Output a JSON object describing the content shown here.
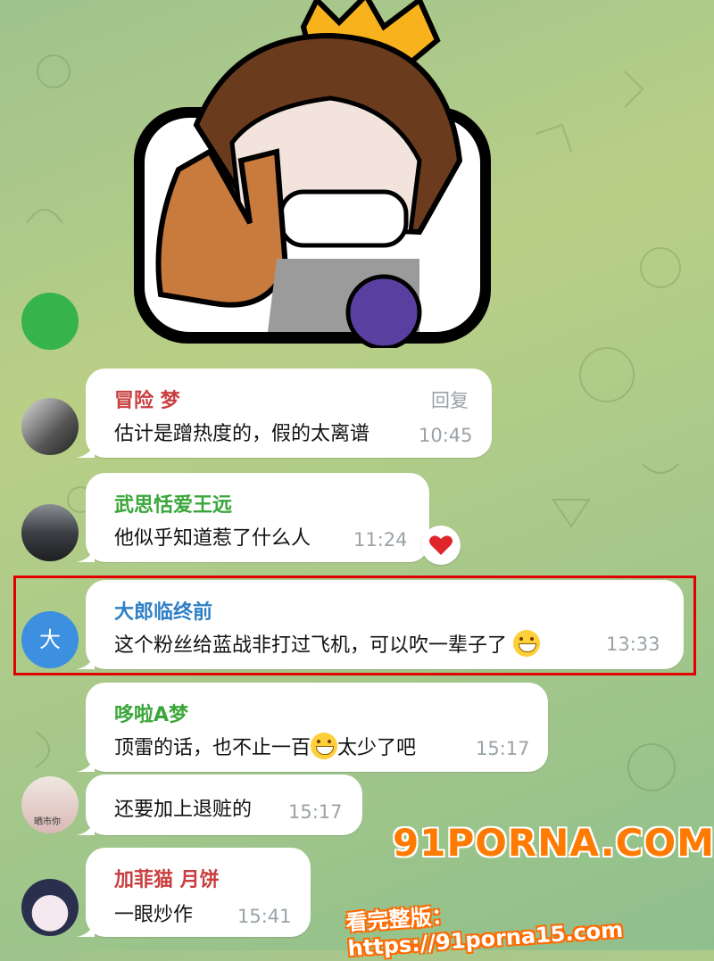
{
  "colors": {
    "accent_red": "#e00000",
    "bubble": "#ffffff",
    "time_gray": "#9aa3a8"
  },
  "messages": [
    {
      "name": "冒险 梦",
      "name_color": "#c93e3e",
      "text": "估计是蹭热度的，假的太离谱",
      "time": "10:45",
      "reply_label": "回复"
    },
    {
      "name": "武思恬爱王远",
      "name_color": "#3aa63a",
      "text": "他似乎知道惹了什么人",
      "time": "11:24",
      "reaction": "heart-icon"
    },
    {
      "name": "大郎临终前",
      "name_color": "#2e7fc6",
      "avatar_letter": "大",
      "text": "这个粉丝给蓝战非打过飞机，可以吹一辈子了",
      "emoji": "grinning-face-icon",
      "time": "13:33"
    },
    {
      "name": "哆啦A梦",
      "name_color": "#3aa63a",
      "text_before": "顶雷的话，也不止一百",
      "emoji": "crying-laughing-icon",
      "text_after": "太少了吧",
      "time": "15:17"
    },
    {
      "text": "还要加上退赃的",
      "time": "15:17",
      "avatar_caption": "晒市你"
    },
    {
      "name": "加菲猫 月饼",
      "name_color": "#c93e3e",
      "text": "一眼炒作",
      "time": "15:41"
    }
  ],
  "watermark": {
    "logo": "91PORNA.COM",
    "line2": "看完整版：https://91porna15.com"
  }
}
